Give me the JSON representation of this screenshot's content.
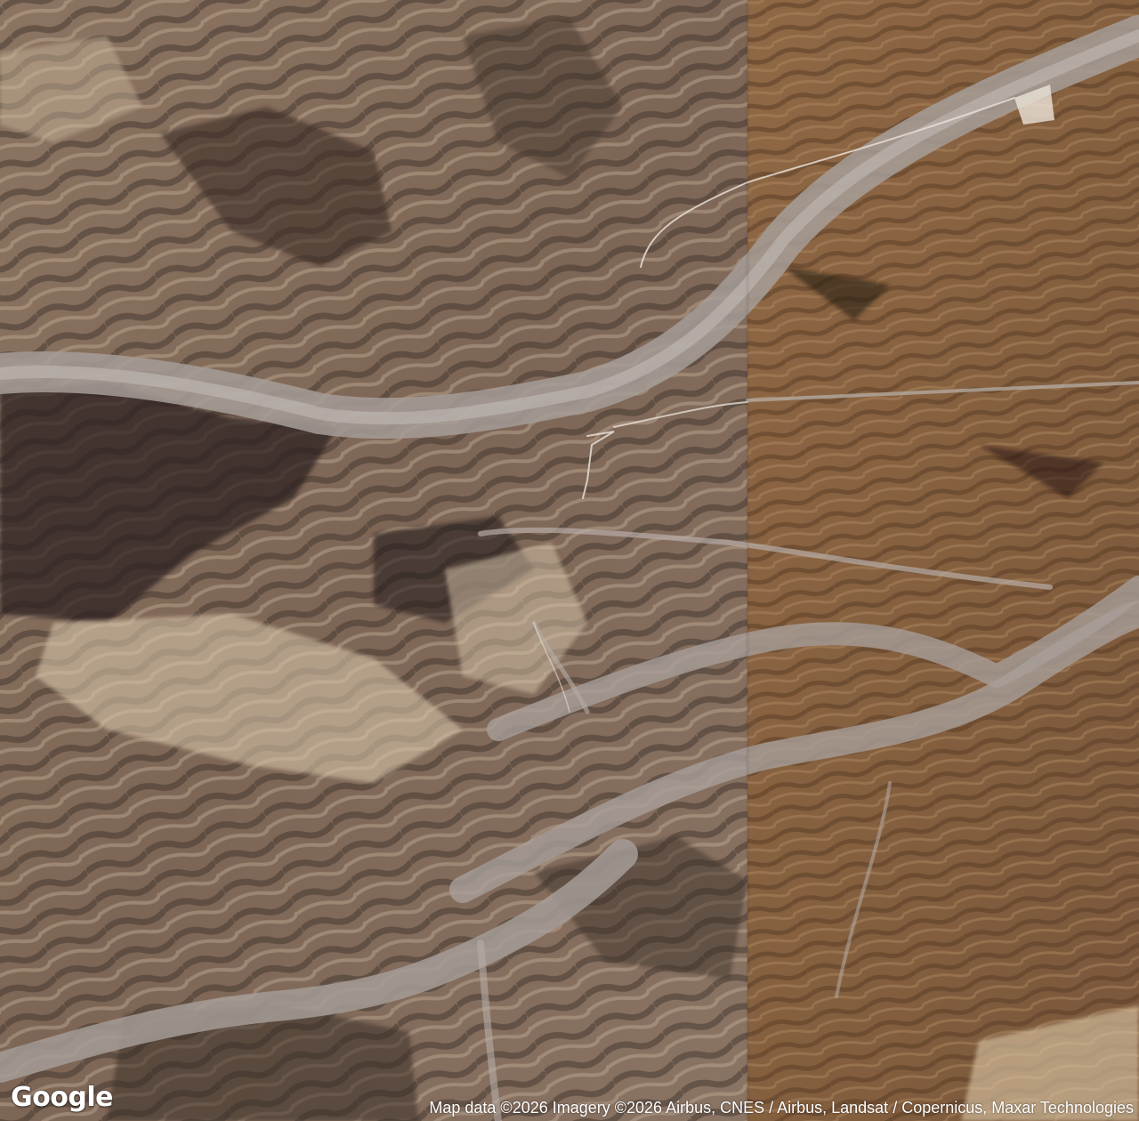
{
  "map": {
    "type": "satellite",
    "branding": {
      "logo_text": "Google"
    },
    "attribution": "Map data ©2026 Imagery ©2026 Airbus, CNES / Airbus, Landsat / Copernicus, Maxar Technologies"
  },
  "colors": {
    "terrain_west": "#8a7260",
    "terrain_east": "#8e6440",
    "riverbed": "#a59a94",
    "shadow": "#2e2620",
    "highlight": "#d8c8b0"
  }
}
